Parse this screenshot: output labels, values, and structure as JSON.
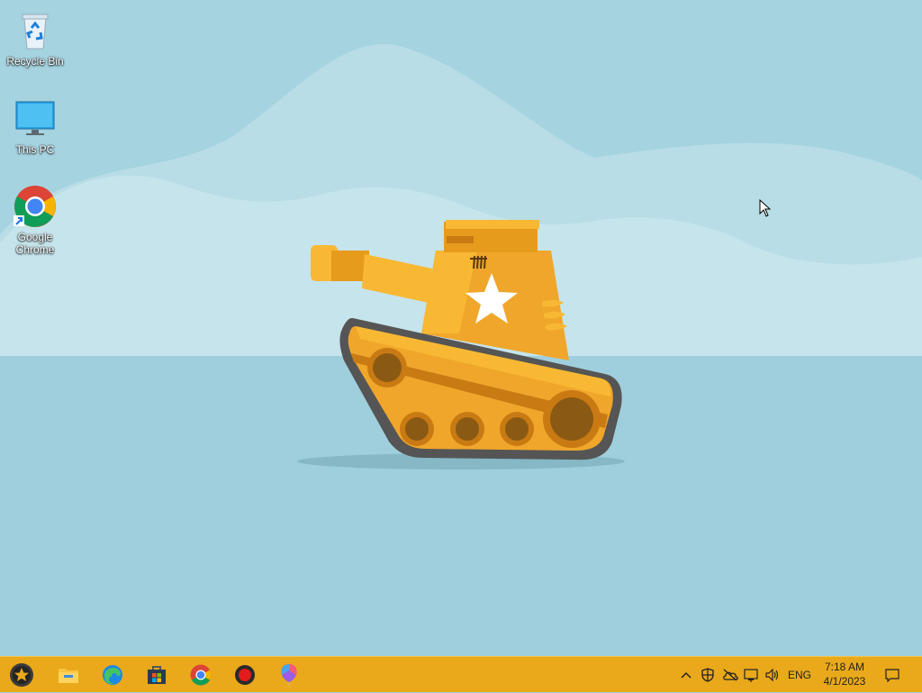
{
  "desktop": {
    "icons": [
      {
        "label": "Recycle Bin"
      },
      {
        "label": "This PC"
      },
      {
        "label": "Google Chrome"
      }
    ]
  },
  "taskbar": {
    "pinned": [
      {
        "icon": "start-star-icon"
      },
      {
        "icon": "file-explorer-icon"
      },
      {
        "icon": "edge-icon"
      },
      {
        "icon": "microsoft-store-icon"
      },
      {
        "icon": "chrome-icon"
      },
      {
        "icon": "record-icon"
      },
      {
        "icon": "paint-balloon-icon"
      }
    ],
    "tray": {
      "icons": [
        "chevron-up-icon",
        "security-shield-icon",
        "onedrive-cloud-icon",
        "network-icon",
        "volume-icon"
      ],
      "language": "ENG",
      "time": "7:18 AM",
      "date": "4/1/2023"
    }
  },
  "colors": {
    "taskbar": "#e9a91a",
    "sky": "#9fcfdc",
    "tank": "#f5a623"
  }
}
